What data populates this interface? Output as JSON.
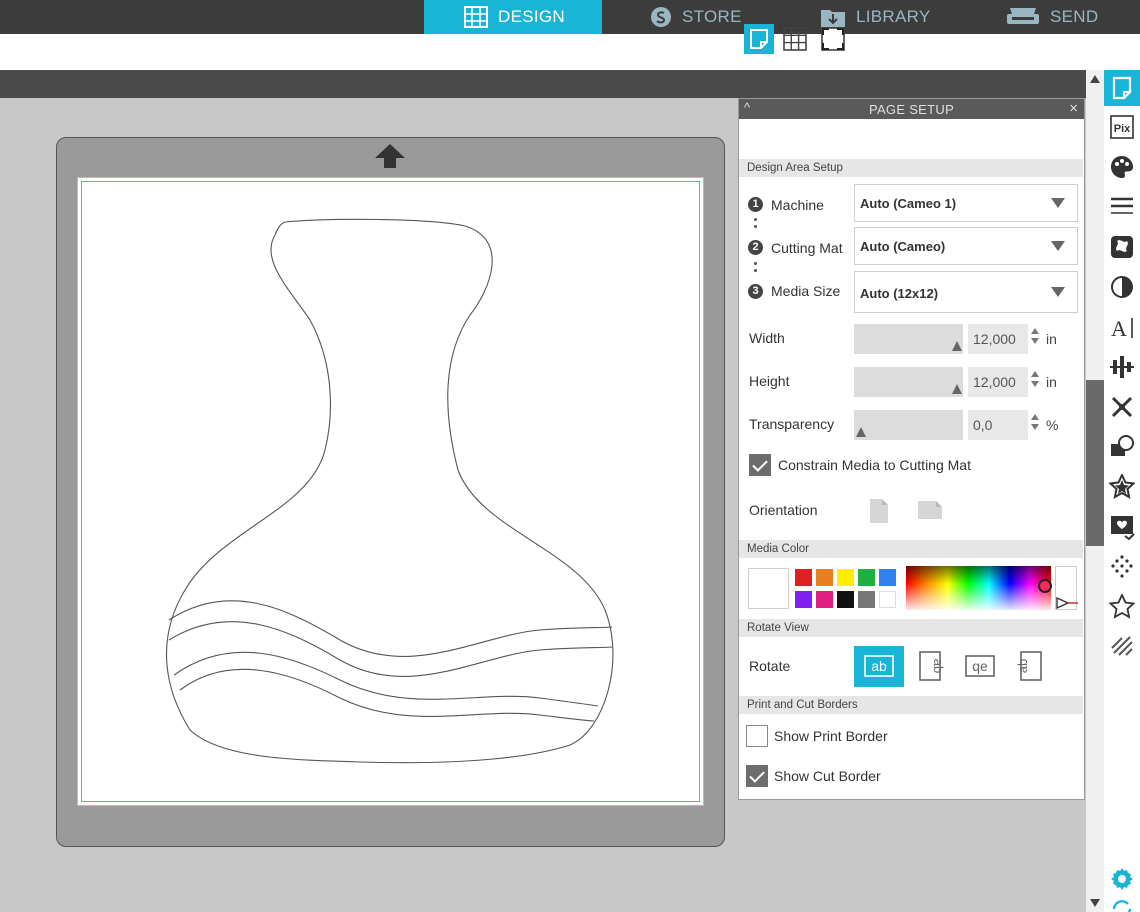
{
  "nav": {
    "tabs": [
      {
        "label": "DESIGN",
        "icon": "grid-icon",
        "active": true
      },
      {
        "label": "STORE",
        "icon": "store-icon",
        "active": false
      },
      {
        "label": "LIBRARY",
        "icon": "library-icon",
        "active": false
      },
      {
        "label": "SEND",
        "icon": "send-icon",
        "active": false
      }
    ]
  },
  "panel": {
    "title": "PAGE SETUP",
    "collapse_glyph": "^",
    "close_glyph": "×",
    "sections": {
      "design_area": "Design Area Setup",
      "media_color": "Media Color",
      "rotate_view": "Rotate View",
      "print_cut": "Print and Cut Borders"
    },
    "steps": [
      {
        "num": "1",
        "label": "Machine",
        "value": "Auto (Cameo 1)"
      },
      {
        "num": "2",
        "label": "Cutting Mat",
        "value": "Auto (Cameo)"
      },
      {
        "num": "3",
        "label": "Media Size",
        "value": "Auto (12x12)"
      }
    ],
    "width": {
      "label": "Width",
      "value": "12,000",
      "unit": "in",
      "level": 1.0
    },
    "height": {
      "label": "Height",
      "value": "12,000",
      "unit": "in",
      "level": 1.0
    },
    "transparency": {
      "label": "Transparency",
      "value": "0,0",
      "unit": "%",
      "level": 0.0
    },
    "constrain": {
      "label": "Constrain Media to Cutting Mat",
      "checked": true
    },
    "orientation": {
      "label": "Orientation"
    },
    "swatches": [
      "#e02020",
      "#e88020",
      "#ffee00",
      "#20b040",
      "#3080f0",
      "#8020f0",
      "#e02080",
      "#111111",
      "#777777",
      "#ffffff"
    ],
    "rotate_label": "Rotate",
    "rotate_glyphs": [
      "ab",
      "ab",
      "qe",
      "ab"
    ],
    "show_print_border": {
      "label": "Show Print Border",
      "checked": false
    },
    "show_cut_border": {
      "label": "Show Cut Border",
      "checked": true
    }
  },
  "colors": {
    "accent": "#19b5d6",
    "topbar": "#3c3c3c",
    "mat": "#9a9a9a",
    "cut_border": "#e87878"
  },
  "toolbar_icons": [
    "page-setup-icon",
    "pixscan-icon",
    "palette-icon",
    "line-style-icon",
    "fill-pattern-icon",
    "contrast-icon",
    "text-style-icon",
    "align-icon",
    "replicate-icon",
    "modify-icon",
    "star-icon",
    "image-trace-icon",
    "rhinestone-icon",
    "star-outline-icon",
    "sketch-icon",
    "settings-icon",
    "refresh-icon"
  ]
}
